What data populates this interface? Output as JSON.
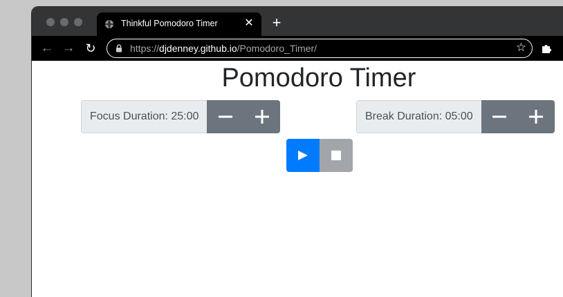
{
  "browser": {
    "tab": {
      "title": "Thinkful Pomodoro Timer",
      "close_glyph": "✕"
    },
    "new_tab_glyph": "+",
    "nav": {
      "back_glyph": "←",
      "forward_glyph": "→",
      "reload_glyph": "↻"
    },
    "address_bar": {
      "scheme": "https://",
      "host": "djdenney.github.io",
      "path": "/Pomodoro_Timer/",
      "bookmark_glyph": "☆"
    },
    "icons": {
      "favicon": "globe-icon",
      "lock": "lock-icon",
      "extensions": "puzzle-piece-icon"
    }
  },
  "app": {
    "title": "Pomodoro Timer",
    "focus": {
      "label": "Focus Duration: 25:00",
      "decrease_icon": "minus-icon",
      "increase_icon": "plus-icon"
    },
    "break": {
      "label": "Break Duration: 05:00",
      "decrease_icon": "minus-icon",
      "increase_icon": "plus-icon"
    },
    "controls": {
      "play_icon": "play-icon",
      "stop_icon": "stop-icon"
    }
  },
  "colors": {
    "primary": "#007bff",
    "secondary": "#6c757d",
    "stop_disabled": "#a2a6aa",
    "input_group_bg": "#e9ecef",
    "title_text": "#212529"
  }
}
